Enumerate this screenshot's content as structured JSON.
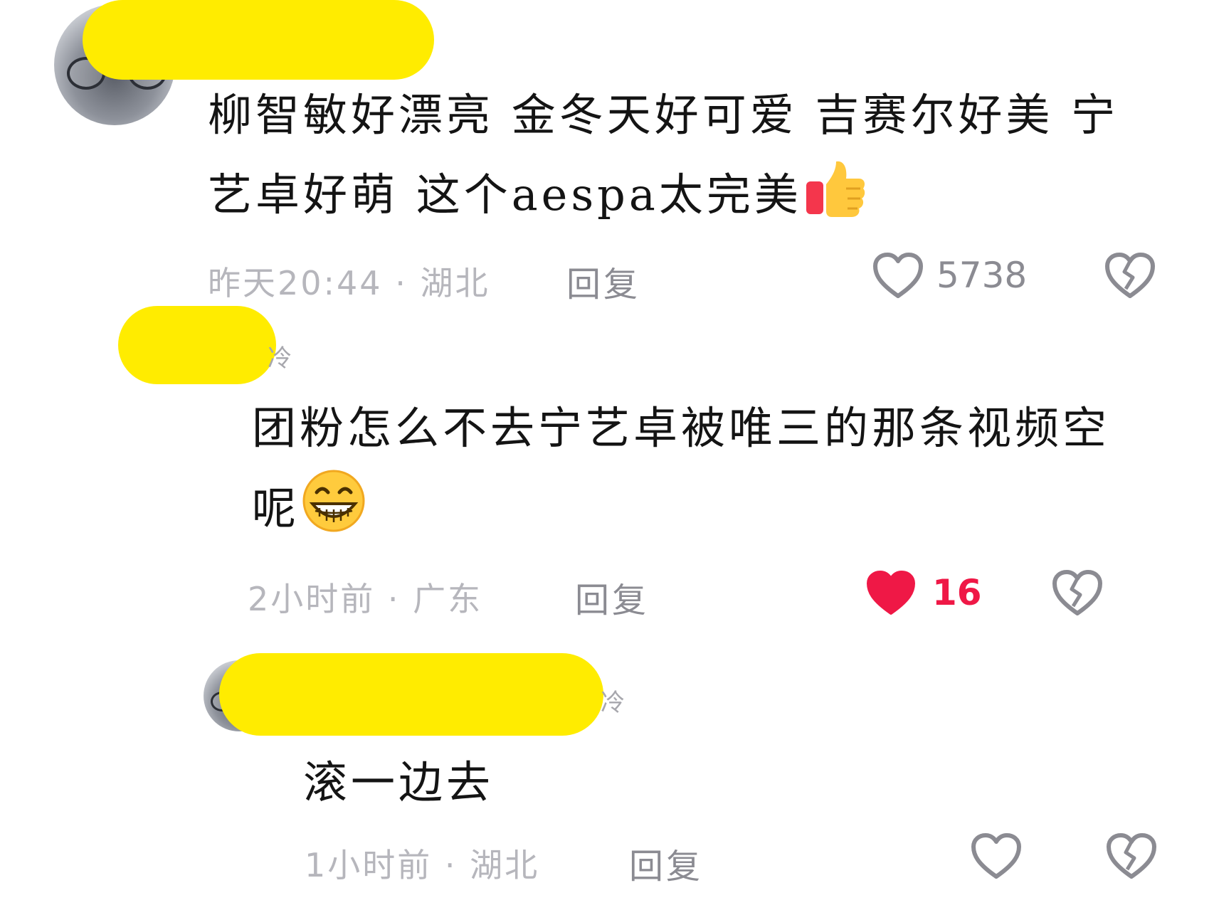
{
  "comments": [
    {
      "username_suffix": "",
      "text": "柳智敏好漂亮 金冬天好可爱 吉赛尔好美 宁艺卓好萌 这个aespa太完美",
      "emoji": "thumbs-up-icon",
      "time": "昨天20:44",
      "separator": "·",
      "location": "湖北",
      "reply_label": "回复",
      "like_count": "5738",
      "liked": false
    },
    {
      "username_suffix": "冷",
      "text": "团粉怎么不去宁艺卓被唯三的那条视频空呢",
      "emoji": "grinning-face-icon",
      "time": "2小时前",
      "separator": "·",
      "location": "广东",
      "reply_label": "回复",
      "like_count": "16",
      "liked": true
    },
    {
      "username_suffix": "冷",
      "text": "滚一边去",
      "emoji": "",
      "time": "1小时前",
      "separator": "·",
      "location": "湖北",
      "reply_label": "回复",
      "like_count": "",
      "liked": false
    }
  ],
  "colors": {
    "liked_red": "#ef1846",
    "redaction_yellow": "#ffec00",
    "meta_gray": "#b6b6bc",
    "icon_gray": "#8b8b92"
  }
}
